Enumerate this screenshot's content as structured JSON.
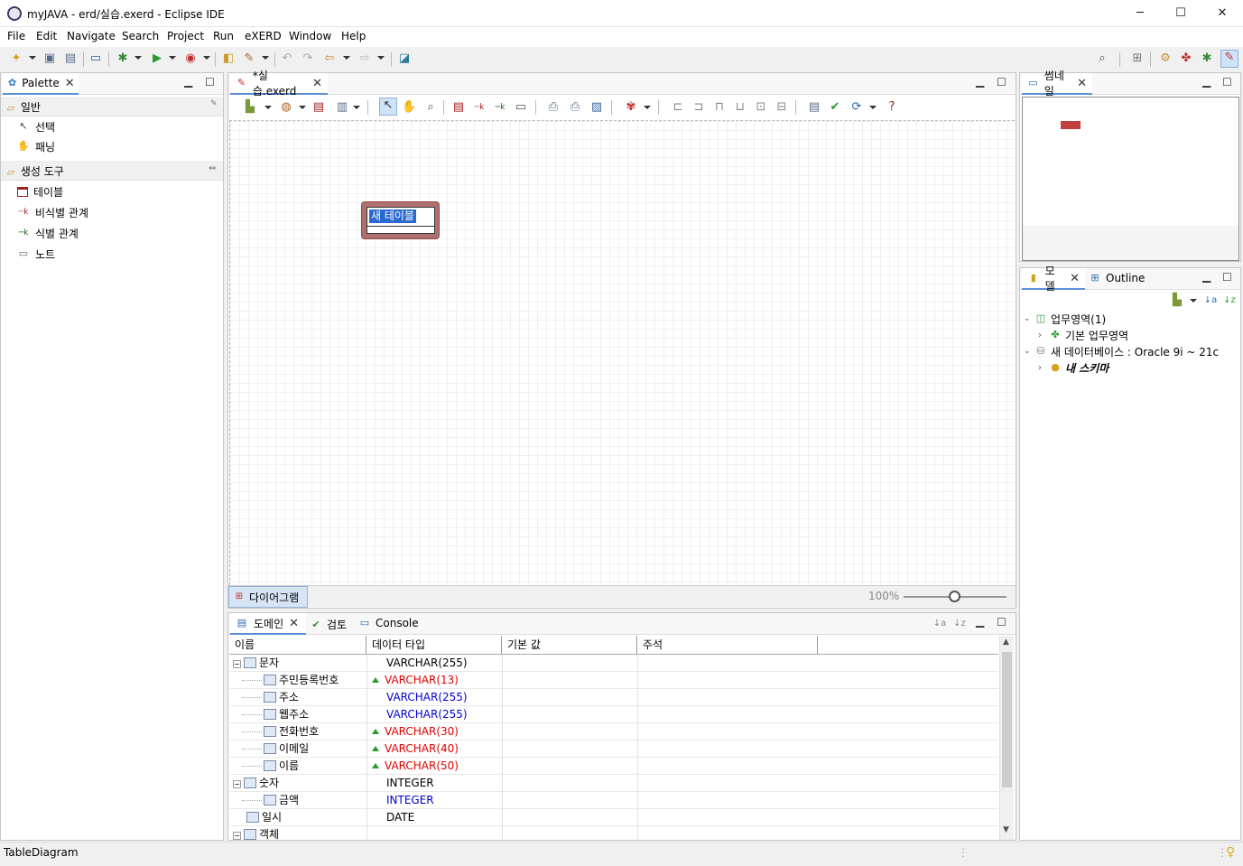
{
  "window": {
    "title": "myJAVA - erd/실습.exerd - Eclipse IDE",
    "minimize": "─",
    "maximize": "☐",
    "close": "✕"
  },
  "menu": [
    "File",
    "Edit",
    "Navigate",
    "Search",
    "Project",
    "Run",
    "eXERD",
    "Window",
    "Help"
  ],
  "palette": {
    "tab": "Palette",
    "section_general": "일반",
    "general_items": [
      "선택",
      "패닝"
    ],
    "section_tools": "생성 도구",
    "tool_items": [
      "테이블",
      "비식별 관계",
      "식별 관계",
      "노트"
    ]
  },
  "editor": {
    "tab": "*실습.exerd",
    "table_name": "새 테이블",
    "bottom_tab": "다이어그램",
    "zoom": "100%",
    "zoom_level": 0.5
  },
  "thumbnail": {
    "tab": "썸네일"
  },
  "model": {
    "tab_model": "모델",
    "tab_outline": "Outline",
    "tree": [
      {
        "label": "업무영역(1)",
        "level": 0,
        "expanded": true
      },
      {
        "label": "기본 업무영역",
        "level": 1,
        "expanded": false
      },
      {
        "label": "새 데이터베이스 : Oracle 9i ~ 21c",
        "level": 0,
        "expanded": true
      },
      {
        "label": "내 스키마",
        "level": 1,
        "expanded": false
      }
    ]
  },
  "domain": {
    "tabs": [
      "도메인",
      "검토",
      "Console"
    ],
    "columns": [
      "이름",
      "데이터 타입",
      "기본 값",
      "주석"
    ],
    "rows": [
      {
        "name": "문자",
        "type": "VARCHAR(255)",
        "level": 0,
        "group": true,
        "color": "black",
        "warn": false
      },
      {
        "name": "주민등록번호",
        "type": "VARCHAR(13)",
        "level": 1,
        "group": false,
        "color": "red",
        "warn": true
      },
      {
        "name": "주소",
        "type": "VARCHAR(255)",
        "level": 1,
        "group": false,
        "color": "blue",
        "warn": false
      },
      {
        "name": "웹주소",
        "type": "VARCHAR(255)",
        "level": 1,
        "group": false,
        "color": "blue",
        "warn": false
      },
      {
        "name": "전화번호",
        "type": "VARCHAR(30)",
        "level": 1,
        "group": false,
        "color": "red",
        "warn": true
      },
      {
        "name": "이메일",
        "type": "VARCHAR(40)",
        "level": 1,
        "group": false,
        "color": "red",
        "warn": true
      },
      {
        "name": "이름",
        "type": "VARCHAR(50)",
        "level": 1,
        "group": false,
        "color": "red",
        "warn": true
      },
      {
        "name": "숫자",
        "type": "INTEGER",
        "level": 0,
        "group": true,
        "color": "black",
        "warn": false
      },
      {
        "name": "금액",
        "type": "INTEGER",
        "level": 1,
        "group": false,
        "color": "blue",
        "warn": false
      },
      {
        "name": "일시",
        "type": "DATE",
        "level": 0,
        "group": false,
        "color": "black",
        "warn": false
      },
      {
        "name": "객체",
        "type": "",
        "level": 0,
        "group": true,
        "color": "black",
        "warn": false
      }
    ]
  },
  "status": {
    "text": "TableDiagram"
  }
}
